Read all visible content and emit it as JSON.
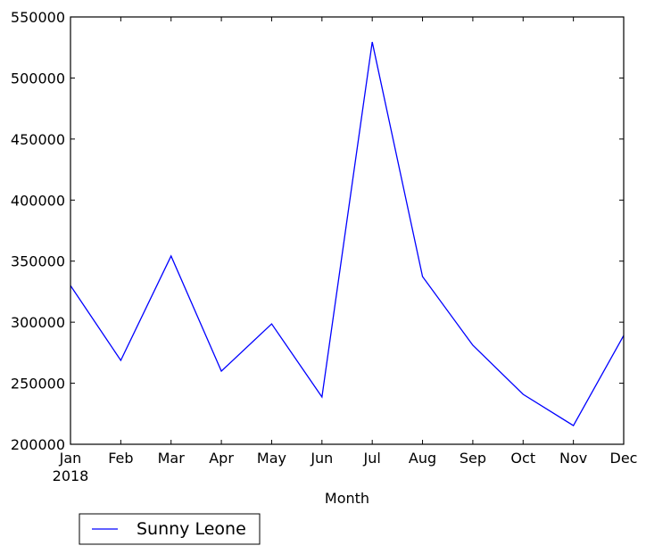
{
  "chart_data": {
    "type": "line",
    "title": "",
    "xlabel": "Month",
    "ylabel": "",
    "categories": [
      "Jan",
      "Feb",
      "Mar",
      "Apr",
      "May",
      "Jun",
      "Jul",
      "Aug",
      "Sep",
      "Oct",
      "Nov",
      "Dec"
    ],
    "x_sublabel": "2018",
    "ylim": [
      200000,
      550000
    ],
    "yticks": [
      200000,
      250000,
      300000,
      350000,
      400000,
      450000,
      500000,
      550000
    ],
    "ytick_labels": [
      "200000",
      "250000",
      "300000",
      "350000",
      "400000",
      "450000",
      "500000",
      "550000"
    ],
    "grid": false,
    "legend_position": "below-left",
    "series": [
      {
        "name": "Sunny Leone",
        "color": "#0000ff",
        "values": [
          330000,
          268700,
          354200,
          259900,
          298600,
          238700,
          529500,
          337400,
          281100,
          240900,
          215300,
          289100
        ]
      }
    ]
  }
}
